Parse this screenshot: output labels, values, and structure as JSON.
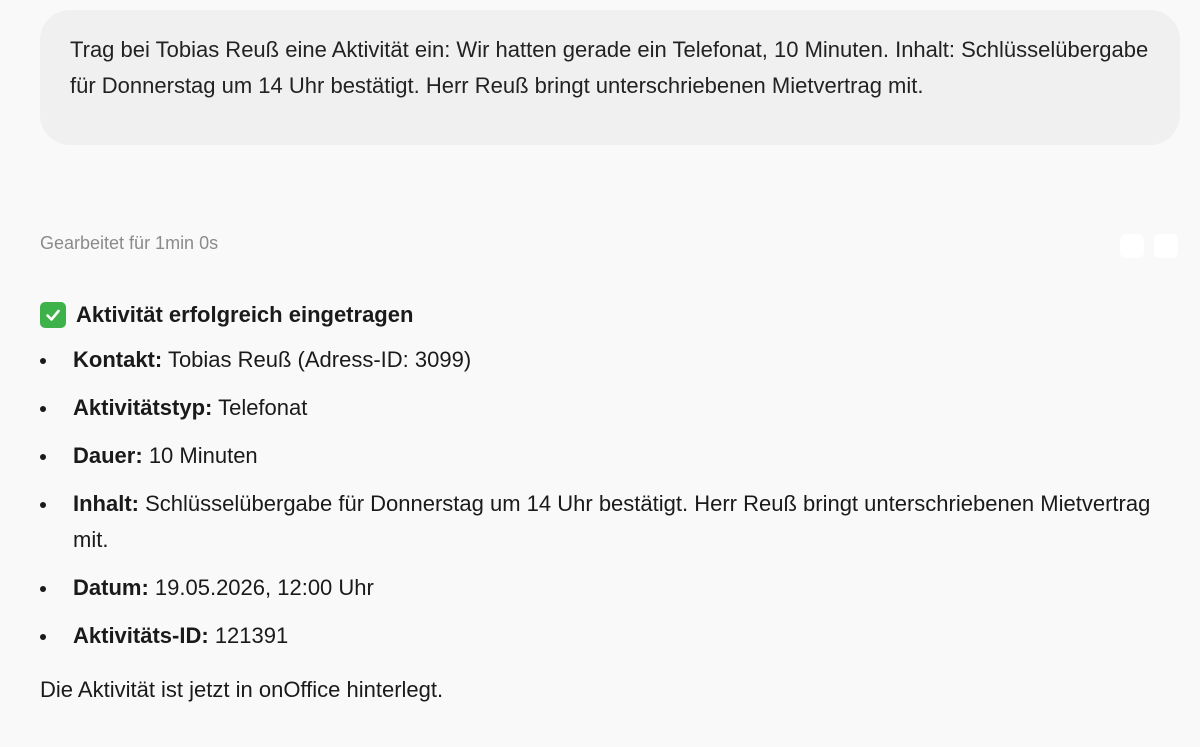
{
  "user_message": {
    "text": "Trag bei Tobias Reuß eine Aktivität ein: Wir hatten gerade ein Telefonat, 10 Minuten. Inhalt: Schlüsselübergabe für Donnerstag um 14 Uhr bestätigt. Herr Reuß bringt unterschriebenen Mietvertrag mit."
  },
  "worked_for": "Gearbeitet für 1min 0s",
  "response": {
    "heading": "Aktivität erfolgreich eingetragen",
    "items": [
      {
        "label": "Kontakt:",
        "value": "Tobias Reuß (Adress-ID: 3099)"
      },
      {
        "label": "Aktivitätstyp:",
        "value": "Telefonat"
      },
      {
        "label": "Dauer:",
        "value": "10 Minuten"
      },
      {
        "label": "Inhalt:",
        "value": "Schlüsselübergabe für Donnerstag um 14 Uhr bestätigt. Herr Reuß bringt unterschriebenen Mietvertrag mit."
      },
      {
        "label": "Datum:",
        "value": "19.05.2026, 12:00 Uhr"
      },
      {
        "label": "Aktivitäts-ID:",
        "value": "121391"
      }
    ],
    "footer": "Die Aktivität ist jetzt in onOffice hinterlegt."
  },
  "icons": {
    "heading_icon": "check-mark-icon"
  },
  "colors": {
    "check_green": "#3db24a",
    "bubble_bg": "#f0f0f0",
    "page_bg": "#f9f9f9",
    "muted_text": "#8b8b8b"
  }
}
